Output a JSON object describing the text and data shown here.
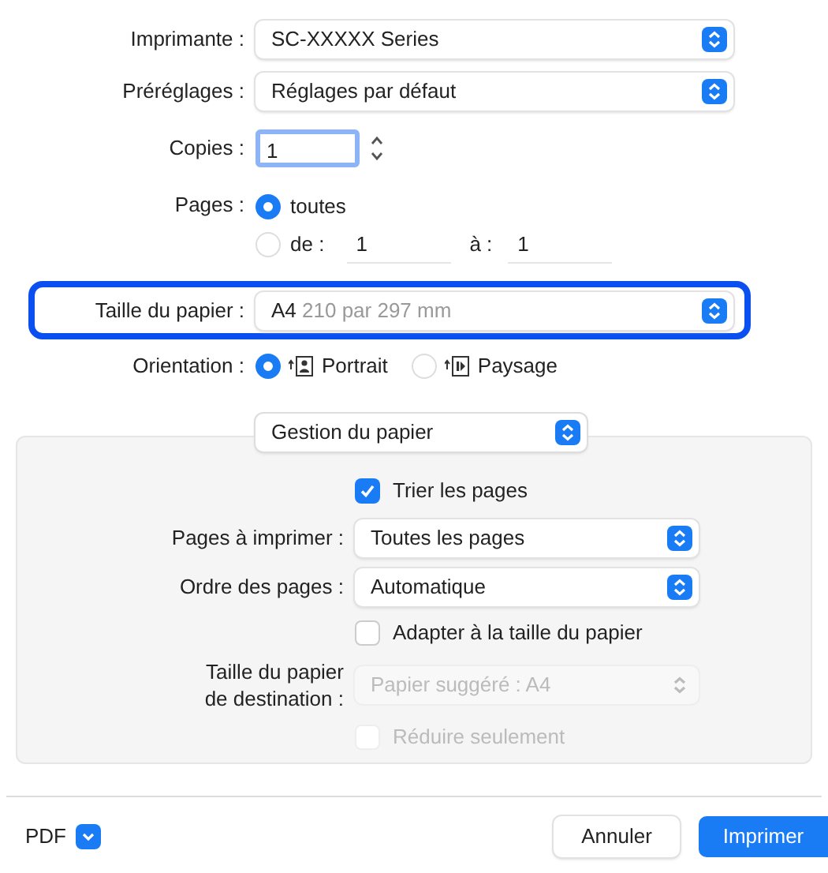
{
  "main_rows": [
    {
      "kind": "popup",
      "label": "Imprimante :",
      "value": "SC-XXXXX Series"
    },
    {
      "kind": "popup",
      "label": "Préréglages :",
      "value": "Réglages par défaut"
    },
    {
      "kind": "stepper",
      "label": "Copies :",
      "value": "1",
      "focused": true
    },
    {
      "kind": "pages",
      "label": "Pages :",
      "options": [
        {
          "label": "toutes",
          "selected": true
        },
        {
          "label": "de :",
          "selected": false,
          "from": "1",
          "to_label": "à :",
          "to": "1"
        }
      ]
    },
    {
      "kind": "paper",
      "label": "Taille du papier :",
      "value": "A4",
      "detail": "210 par 297 mm",
      "highlighted": true
    },
    {
      "kind": "orientation",
      "label": "Orientation :",
      "options": [
        {
          "label": "Portrait",
          "selected": true
        },
        {
          "label": "Paysage",
          "selected": false
        }
      ]
    }
  ],
  "section_popup": "Gestion du papier",
  "panel_rows": [
    {
      "kind": "checkbox",
      "label": "Trier les pages",
      "checked": true,
      "disabled": false
    },
    {
      "kind": "popup",
      "label": "Pages à imprimer :",
      "value": "Toutes les pages",
      "disabled": false
    },
    {
      "kind": "popup",
      "label": "Ordre des pages :",
      "value": "Automatique",
      "disabled": false
    },
    {
      "kind": "checkbox",
      "label": "Adapter à la taille du papier",
      "checked": false,
      "disabled": false
    },
    {
      "kind": "popup",
      "label": "Taille du papier\nde destination :",
      "value": "Papier suggéré : A4",
      "disabled": true
    },
    {
      "kind": "checkbox",
      "label": "Réduire seulement",
      "checked": false,
      "disabled": true
    }
  ],
  "footer": {
    "pdf": "PDF",
    "buttons": [
      {
        "label": "Annuler",
        "primary": false
      },
      {
        "label": "Imprimer",
        "primary": true
      }
    ]
  }
}
